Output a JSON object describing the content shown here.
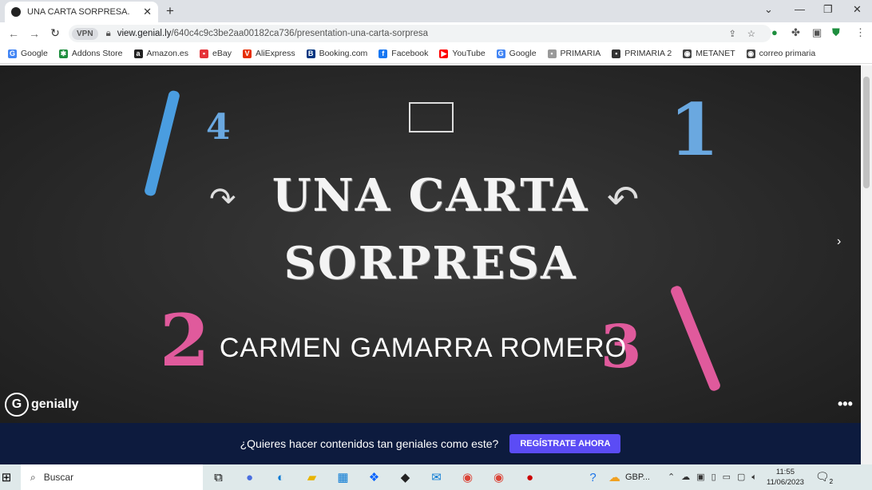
{
  "browser": {
    "tab_title": "UNA CARTA SORPRESA.",
    "url_domain": "view.genial.ly",
    "url_path": "/640c4c9c3be2aa00182ca736/presentation-una-carta-sorpresa",
    "vpn_label": "VPN"
  },
  "bookmarks": [
    {
      "label": "Google",
      "color": "#4285f4",
      "glyph": "G"
    },
    {
      "label": "Addons Store",
      "color": "#1e8e3e",
      "glyph": "✱"
    },
    {
      "label": "Amazon.es",
      "color": "#222",
      "glyph": "a"
    },
    {
      "label": "eBay",
      "color": "#e53238",
      "glyph": "▪"
    },
    {
      "label": "AliExpress",
      "color": "#e62e04",
      "glyph": "V"
    },
    {
      "label": "Booking.com",
      "color": "#003580",
      "glyph": "B"
    },
    {
      "label": "Facebook",
      "color": "#1877f2",
      "glyph": "f"
    },
    {
      "label": "YouTube",
      "color": "#ff0000",
      "glyph": "▶"
    },
    {
      "label": "Google",
      "color": "#4285f4",
      "glyph": "G"
    },
    {
      "label": "PRIMARIA",
      "color": "#999",
      "glyph": "▪"
    },
    {
      "label": "PRIMARIA 2",
      "color": "#333",
      "glyph": "▪"
    },
    {
      "label": "METANET",
      "color": "#444",
      "glyph": "◉"
    },
    {
      "label": "correo primaria",
      "color": "#444",
      "glyph": "◉"
    }
  ],
  "slide": {
    "title_line1": "UNA CARTA",
    "title_line2": "SORPRESA",
    "author": "CARMEN GAMARRA ROMERO",
    "numbers": [
      "4",
      "1",
      "2",
      "3"
    ],
    "logo": "genially"
  },
  "banner": {
    "text": "¿Quieres hacer contenidos tan geniales como este?",
    "cta": "REGÍSTRATE AHORA"
  },
  "taskbar": {
    "search_placeholder": "Buscar",
    "app_label": "GBP...",
    "time": "11:55",
    "date": "11/06/2023",
    "notifications": "2"
  }
}
